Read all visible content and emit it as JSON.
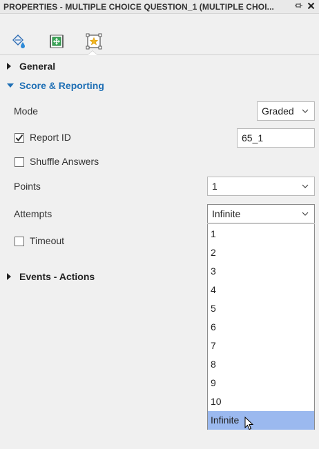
{
  "title_bar": {
    "title": "PROPERTIES - MULTIPLE CHOICE QUESTION_1 (MULTIPLE CHOI...",
    "pin_icon": "pin-icon",
    "close_icon": "close-icon"
  },
  "tabs": [
    {
      "icon": "paint-bucket-icon",
      "selected": false
    },
    {
      "icon": "position-size-icon",
      "selected": false
    },
    {
      "icon": "star-frame-icon",
      "selected": true
    }
  ],
  "sections": {
    "general": {
      "label": "General",
      "expanded": false
    },
    "score": {
      "label": "Score & Reporting",
      "expanded": true
    },
    "events": {
      "label": "Events - Actions",
      "expanded": false
    }
  },
  "score": {
    "mode_label": "Mode",
    "mode_value": "Graded",
    "report_id_label": "Report ID",
    "report_id_checked": true,
    "report_id_value": "65_1",
    "shuffle_label": "Shuffle Answers",
    "shuffle_checked": false,
    "points_label": "Points",
    "points_value": "1",
    "attempts_label": "Attempts",
    "attempts_value": "Infinite",
    "timeout_label": "Timeout",
    "timeout_checked": false
  },
  "attempts_options": [
    "1",
    "2",
    "3",
    "4",
    "5",
    "6",
    "7",
    "8",
    "9",
    "10",
    "Infinite"
  ],
  "attempts_highlighted": "Infinite",
  "colors": {
    "accent": "#1e6fb5",
    "highlight": "#9bb9ef",
    "panel_bg": "#f0f0f0"
  }
}
